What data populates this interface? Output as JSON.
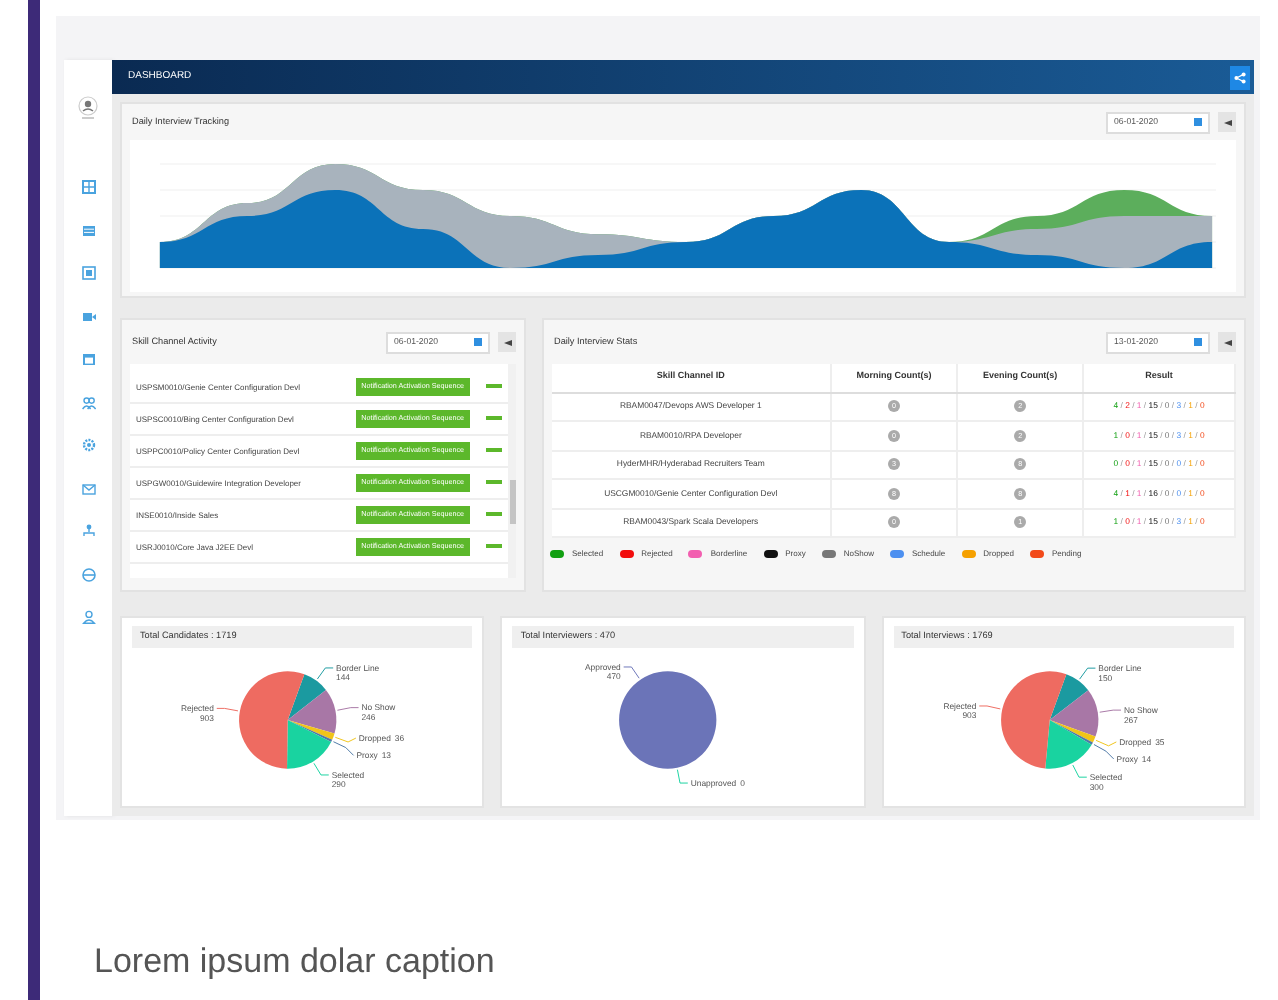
{
  "header": {
    "title": "DASHBOARD"
  },
  "tracking": {
    "title": "Daily Interview Tracking",
    "date": "06-01-2020"
  },
  "activity": {
    "title": "Skill Channel Activity",
    "date": "06-01-2020",
    "rows": [
      {
        "name": "USPSM0010/Genie Center Configuration Devl",
        "badge": "Notification Activation Sequence"
      },
      {
        "name": "USPSC0010/Bing Center Configuration Devl",
        "badge": "Notification Activation Sequence"
      },
      {
        "name": "USPPC0010/Policy Center Configuration Devl",
        "badge": "Notification Activation Sequence"
      },
      {
        "name": "USPGW0010/Guidewire Integration Developer",
        "badge": "Notification Activation Sequence"
      },
      {
        "name": "INSE0010/Inside Sales",
        "badge": "Notification Activation Sequence"
      },
      {
        "name": "USRJ0010/Core Java J2EE Devl",
        "badge": "Notification Activation Sequence"
      }
    ]
  },
  "stats": {
    "title": "Daily Interview Stats",
    "date": "13-01-2020",
    "separator": "/",
    "columns": [
      "Skill Channel ID",
      "Morning Count(s)",
      "Evening Count(s)",
      "Result"
    ],
    "rows": [
      {
        "channel": "RBAM0047/Devops AWS Developer 1",
        "morning": "0",
        "evening": "2",
        "result": [
          "4",
          "2",
          "1",
          "15",
          "0",
          "3",
          "1",
          "0"
        ]
      },
      {
        "channel": "RBAM0010/RPA Developer",
        "morning": "0",
        "evening": "2",
        "result": [
          "1",
          "0",
          "1",
          "15",
          "0",
          "3",
          "1",
          "0"
        ]
      },
      {
        "channel": "HyderMHR/Hyderabad Recruiters Team",
        "morning": "3",
        "evening": "8",
        "result": [
          "0",
          "0",
          "1",
          "15",
          "0",
          "0",
          "1",
          "0"
        ]
      },
      {
        "channel": "USCGM0010/Genie Center Configuration Devl",
        "morning": "8",
        "evening": "8",
        "result": [
          "4",
          "1",
          "1",
          "16",
          "0",
          "0",
          "1",
          "0"
        ]
      },
      {
        "channel": "RBAM0043/Spark Scala Developers",
        "morning": "0",
        "evening": "1",
        "result": [
          "1",
          "0",
          "1",
          "15",
          "0",
          "3",
          "1",
          "0"
        ]
      }
    ],
    "legend": [
      {
        "label": "Selected",
        "color": "#12a012"
      },
      {
        "label": "Rejected",
        "color": "#f20d0d"
      },
      {
        "label": "Borderline",
        "color": "#f25fb0"
      },
      {
        "label": "Proxy",
        "color": "#111111"
      },
      {
        "label": "NoShow",
        "color": "#777777"
      },
      {
        "label": "Schedule",
        "color": "#4d90f0"
      },
      {
        "label": "Dropped",
        "color": "#f5a000"
      },
      {
        "label": "Pending",
        "color": "#f24a1a"
      }
    ]
  },
  "summaries": [
    {
      "title": "Total Candidates : 1719",
      "chart_data": {
        "type": "pie",
        "categories": [
          "Border Line",
          "No Show",
          "Dropped",
          "Proxy",
          "Selected",
          "Rejected"
        ],
        "values": [
          144,
          246,
          36,
          13,
          290,
          903
        ],
        "colors": [
          "#1b9aa0",
          "#a877a6",
          "#f0c419",
          "#4e79a7",
          "#19d3a0",
          "#ee6b61"
        ],
        "data_labels": true
      }
    },
    {
      "title": "Total Interviewers : 470",
      "chart_data": {
        "type": "pie",
        "categories": [
          "Unapproved",
          "Approved"
        ],
        "values": [
          0,
          470
        ],
        "colors": [
          "#19d3a0",
          "#6b74b8"
        ],
        "value_labels": [
          "0",
          "470"
        ]
      }
    },
    {
      "title": "Total Interviews : 1769",
      "chart_data": {
        "type": "pie",
        "categories": [
          "Border Line",
          "No Show",
          "Dropped",
          "Proxy",
          "Selected",
          "Rejected"
        ],
        "values": [
          150,
          267,
          35,
          14,
          300,
          903
        ],
        "colors": [
          "#1b9aa0",
          "#a877a6",
          "#f0c419",
          "#4e79a7",
          "#19d3a0",
          "#ee6b61"
        ],
        "data_labels": true
      }
    }
  ],
  "caption": "Lorem ipsum dolar caption"
}
